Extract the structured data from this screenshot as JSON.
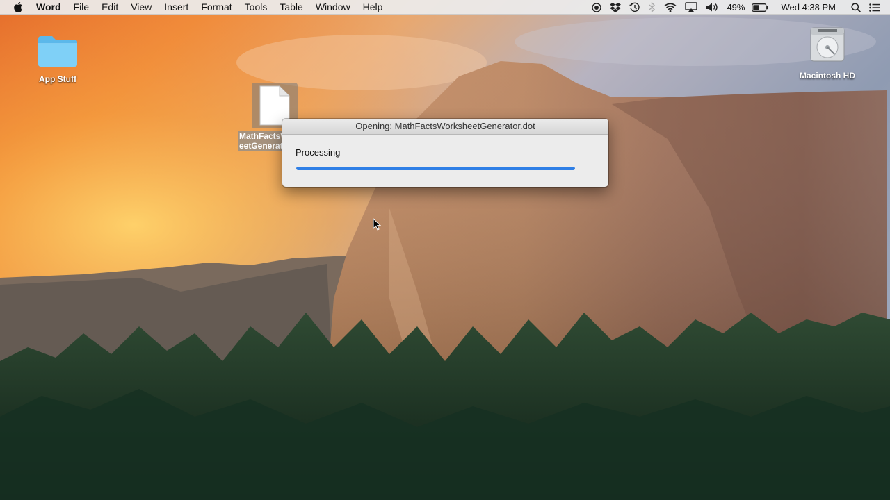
{
  "menubar": {
    "app_name": "Word",
    "menus": [
      "File",
      "Edit",
      "View",
      "Insert",
      "Format",
      "Tools",
      "Table",
      "Window",
      "Help"
    ],
    "status_icons": [
      "record-icon",
      "dropbox-icon",
      "time-machine-icon",
      "bluetooth-icon",
      "wifi-icon",
      "airplay-icon",
      "volume-icon"
    ],
    "battery_percent": "49%",
    "battery_level": 0.49,
    "clock": "Wed 4:38 PM"
  },
  "desktop": {
    "folder_label": "App Stuff",
    "drive_label": "Macintosh HD",
    "document_label": "MathFactsWorksheetGenerator.dot",
    "document_label_line1": "MathFactsW",
    "document_label_line2": "eetGenerat"
  },
  "dialog": {
    "title": "Opening: MathFactsWorksheetGenerator.dot",
    "status": "Processing",
    "progress": 1.0
  },
  "colors": {
    "progress_blue": "#2f7fe6",
    "menubar_bg": "#ececec"
  }
}
